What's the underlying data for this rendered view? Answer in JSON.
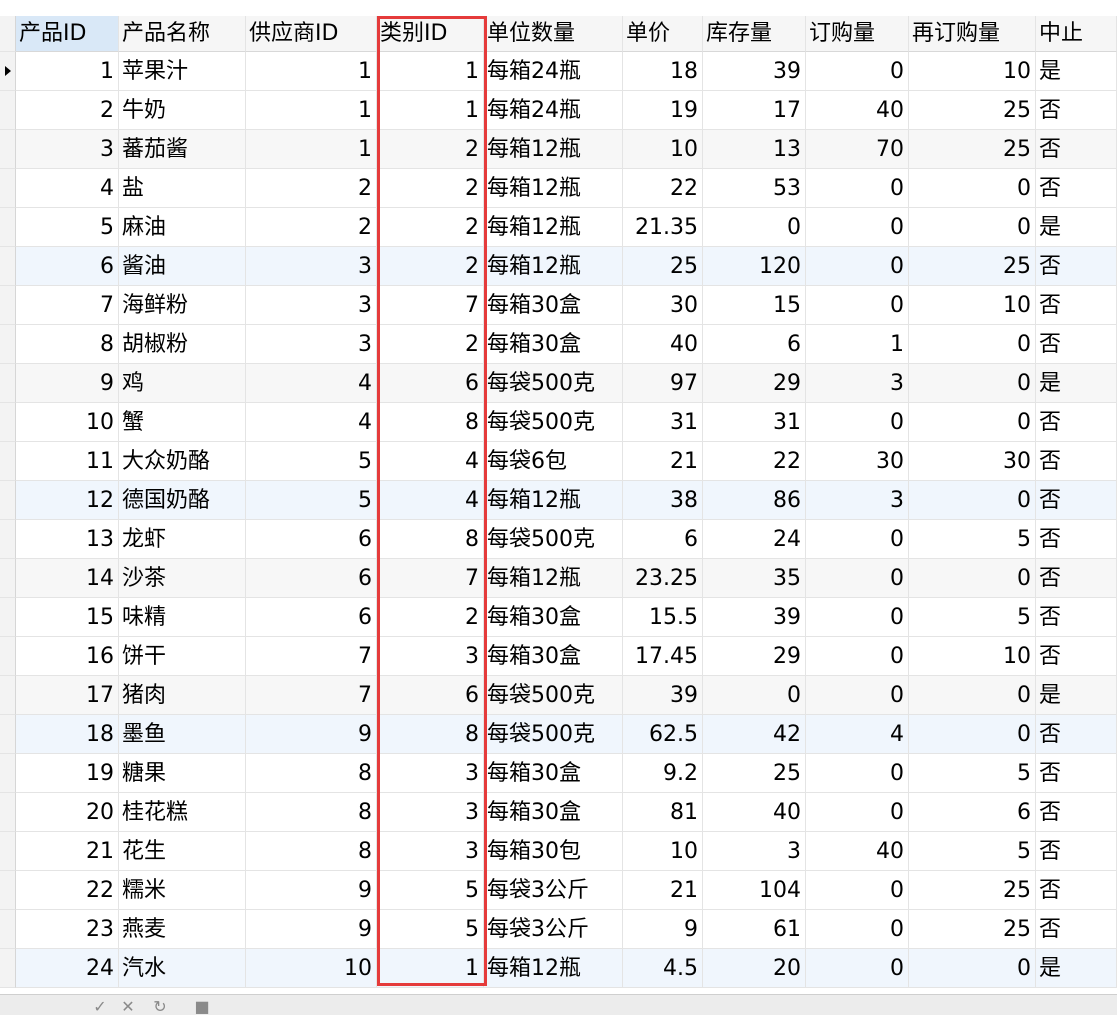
{
  "table": {
    "columns": [
      "产品ID",
      "产品名称",
      "供应商ID",
      "类别ID",
      "单位数量",
      "单价",
      "库存量",
      "订购量",
      "再订购量",
      "中止"
    ],
    "rows": [
      [
        "1",
        "苹果汁",
        "1",
        "1",
        "每箱24瓶",
        "18",
        "39",
        "0",
        "10",
        "是"
      ],
      [
        "2",
        "牛奶",
        "1",
        "1",
        "每箱24瓶",
        "19",
        "17",
        "40",
        "25",
        "否"
      ],
      [
        "3",
        "蕃茄酱",
        "1",
        "2",
        "每箱12瓶",
        "10",
        "13",
        "70",
        "25",
        "否"
      ],
      [
        "4",
        "盐",
        "2",
        "2",
        "每箱12瓶",
        "22",
        "53",
        "0",
        "0",
        "否"
      ],
      [
        "5",
        "麻油",
        "2",
        "2",
        "每箱12瓶",
        "21.35",
        "0",
        "0",
        "0",
        "是"
      ],
      [
        "6",
        "酱油",
        "3",
        "2",
        "每箱12瓶",
        "25",
        "120",
        "0",
        "25",
        "否"
      ],
      [
        "7",
        "海鲜粉",
        "3",
        "7",
        "每箱30盒",
        "30",
        "15",
        "0",
        "10",
        "否"
      ],
      [
        "8",
        "胡椒粉",
        "3",
        "2",
        "每箱30盒",
        "40",
        "6",
        "1",
        "0",
        "否"
      ],
      [
        "9",
        "鸡",
        "4",
        "6",
        "每袋500克",
        "97",
        "29",
        "3",
        "0",
        "是"
      ],
      [
        "10",
        "蟹",
        "4",
        "8",
        "每袋500克",
        "31",
        "31",
        "0",
        "0",
        "否"
      ],
      [
        "11",
        "大众奶酪",
        "5",
        "4",
        "每袋6包",
        "21",
        "22",
        "30",
        "30",
        "否"
      ],
      [
        "12",
        "德国奶酪",
        "5",
        "4",
        "每箱12瓶",
        "38",
        "86",
        "3",
        "0",
        "否"
      ],
      [
        "13",
        "龙虾",
        "6",
        "8",
        "每袋500克",
        "6",
        "24",
        "0",
        "5",
        "否"
      ],
      [
        "14",
        "沙茶",
        "6",
        "7",
        "每箱12瓶",
        "23.25",
        "35",
        "0",
        "0",
        "否"
      ],
      [
        "15",
        "味精",
        "6",
        "2",
        "每箱30盒",
        "15.5",
        "39",
        "0",
        "5",
        "否"
      ],
      [
        "16",
        "饼干",
        "7",
        "3",
        "每箱30盒",
        "17.45",
        "29",
        "0",
        "10",
        "否"
      ],
      [
        "17",
        "猪肉",
        "7",
        "6",
        "每袋500克",
        "39",
        "0",
        "0",
        "0",
        "是"
      ],
      [
        "18",
        "墨鱼",
        "9",
        "8",
        "每袋500克",
        "62.5",
        "42",
        "4",
        "0",
        "否"
      ],
      [
        "19",
        "糖果",
        "8",
        "3",
        "每箱30盒",
        "9.2",
        "25",
        "0",
        "5",
        "否"
      ],
      [
        "20",
        "桂花糕",
        "8",
        "3",
        "每箱30盒",
        "81",
        "40",
        "0",
        "6",
        "否"
      ],
      [
        "21",
        "花生",
        "8",
        "3",
        "每箱30包",
        "10",
        "3",
        "40",
        "5",
        "否"
      ],
      [
        "22",
        "糯米",
        "9",
        "5",
        "每袋3公斤",
        "21",
        "104",
        "0",
        "25",
        "否"
      ],
      [
        "23",
        "燕麦",
        "9",
        "5",
        "每袋3公斤",
        "9",
        "61",
        "0",
        "25",
        "否"
      ],
      [
        "24",
        "汽水",
        "10",
        "1",
        "每箱12瓶",
        "4.5",
        "20",
        "0",
        "0",
        "是"
      ]
    ]
  },
  "highlight_column": "类别ID",
  "colors": {
    "highlight": "#e53b3b",
    "header_selected": "#d9e8f7",
    "row_alt": "#f7f7f7",
    "row_blue": "#f0f6fd"
  },
  "toolbar": {
    "icons": [
      "check-icon",
      "cancel-icon",
      "refresh-icon",
      "stop-icon"
    ]
  }
}
